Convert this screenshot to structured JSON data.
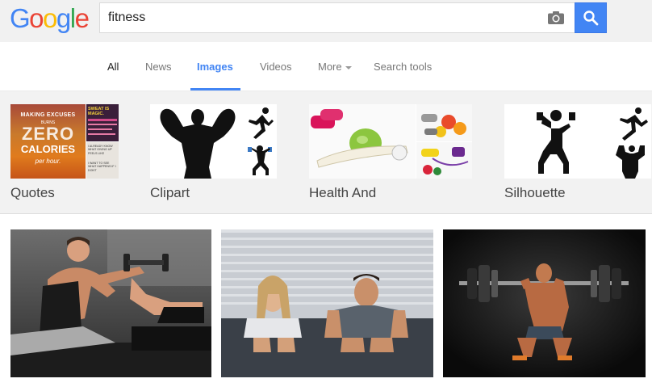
{
  "search": {
    "query": "fitness"
  },
  "logo": {
    "letters": [
      "G",
      "o",
      "o",
      "g",
      "l",
      "e"
    ],
    "colors": [
      "#4285f4",
      "#ea4335",
      "#fbbc05",
      "#4285f4",
      "#34a853",
      "#ea4335"
    ]
  },
  "tabs": {
    "all": "All",
    "news": "News",
    "images": "Images",
    "videos": "Videos",
    "more": "More",
    "search_tools": "Search tools"
  },
  "related": [
    {
      "label": "Quotes",
      "thumb_text": {
        "making": "MAKING EXCUSES",
        "burns": "BURNS",
        "zero": "ZERO",
        "calories": "CALORIES",
        "per": "per hour.",
        "sweat": "SWEAT IS MAGIC.",
        "quote2": "I ALREADY KNOW WHAT GIVING UP FEELS LIKE",
        "quote3": "I WANT TO SEE WHAT HAPPENS IF I DON'T"
      }
    },
    {
      "label": "Clipart"
    },
    {
      "label": "Health And"
    },
    {
      "label": "Silhouette"
    }
  ],
  "colors": {
    "accent": "#4285f4",
    "tab_text": "#777777",
    "header_bg": "#f1f1f1"
  },
  "icons": {
    "camera": "camera-icon",
    "search": "magnifier-icon"
  }
}
